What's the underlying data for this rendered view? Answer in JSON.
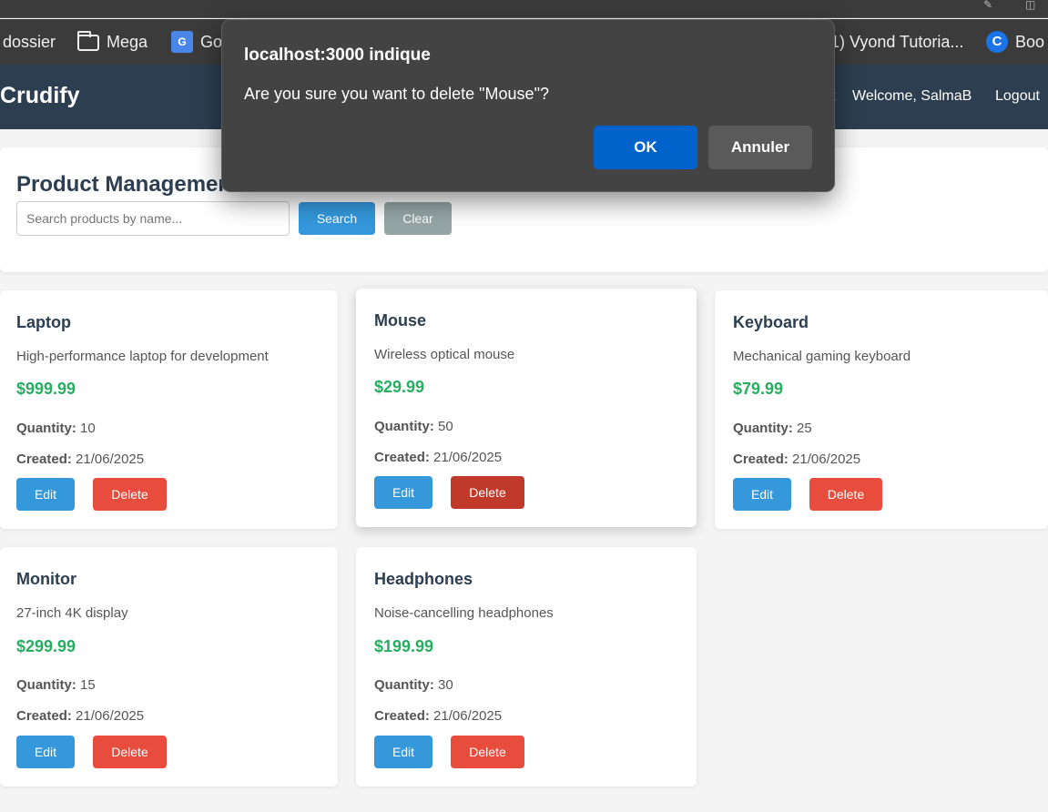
{
  "bookmarks": [
    {
      "label": "dossier",
      "icon": "folder-icon"
    },
    {
      "label": "Mega",
      "icon": "folder-icon"
    },
    {
      "label": "Go",
      "icon": "google-translate-icon"
    },
    {
      "label": "1) Vyond Tutoria...",
      "icon": ""
    },
    {
      "label": "Boo",
      "icon": "c-icon"
    }
  ],
  "navbar": {
    "brand": "Crudify",
    "partial_link": "t",
    "welcome": "Welcome, SalmaB",
    "logout": "Logout"
  },
  "management": {
    "title": "Product Management",
    "search_placeholder": "Search products by name...",
    "search_label": "Search",
    "clear_label": "Clear"
  },
  "labels": {
    "quantity": "Quantity:",
    "created": "Created:",
    "edit": "Edit",
    "delete": "Delete"
  },
  "products": [
    {
      "name": "Laptop",
      "description": "High-performance laptop for development",
      "price": "$999.99",
      "quantity": "10",
      "created": "21/06/2025"
    },
    {
      "name": "Mouse",
      "description": "Wireless optical mouse",
      "price": "$29.99",
      "quantity": "50",
      "created": "21/06/2025"
    },
    {
      "name": "Keyboard",
      "description": "Mechanical gaming keyboard",
      "price": "$79.99",
      "quantity": "25",
      "created": "21/06/2025"
    },
    {
      "name": "Monitor",
      "description": "27-inch 4K display",
      "price": "$299.99",
      "quantity": "15",
      "created": "21/06/2025"
    },
    {
      "name": "Headphones",
      "description": "Noise-cancelling headphones",
      "price": "$199.99",
      "quantity": "30",
      "created": "21/06/2025"
    }
  ],
  "dialog": {
    "title": "localhost:3000 indique",
    "message": "Are you sure you want to delete \"Mouse\"?",
    "ok_label": "OK",
    "cancel_label": "Annuler"
  },
  "colors": {
    "navbar": "#2c3e50",
    "primary": "#3498db",
    "danger": "#e74c3c",
    "danger_active": "#c0392b",
    "price": "#27ae60",
    "clear": "#95a5a6",
    "dialog_ok": "#0063cc"
  }
}
